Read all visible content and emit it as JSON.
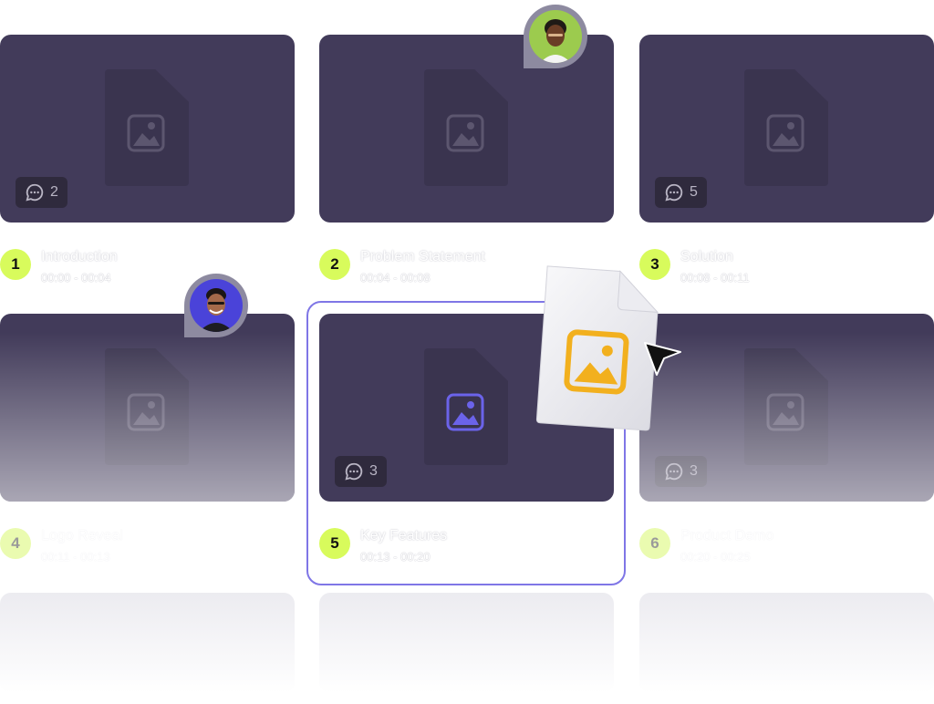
{
  "colors": {
    "card_bg": "#423b5a",
    "number_badge": "#d8fb5c",
    "selection_border": "#7f76e6",
    "accent_icon": "#6b63ea",
    "drag_icon": "#f2b01e"
  },
  "scenes": [
    {
      "number": "1",
      "title": "Introduction",
      "time": "00:00 - 00:04",
      "comments": "2"
    },
    {
      "number": "2",
      "title": "Problem Statement",
      "time": "00:04 - 00:08",
      "comments": ""
    },
    {
      "number": "3",
      "title": "Solution",
      "time": "00:08 - 00:11",
      "comments": "5"
    },
    {
      "number": "4",
      "title": "Logo Reveal",
      "time": "00:11 - 00:13",
      "comments": ""
    },
    {
      "number": "5",
      "title": "Key Features",
      "time": "00:13 - 00:20",
      "comments": "3"
    },
    {
      "number": "6",
      "title": "Product Demo",
      "time": "00:20 - 00:25",
      "comments": "3"
    }
  ],
  "icons": {
    "comment": "comment-bubble-icon",
    "image": "image-file-icon",
    "cursor": "cursor-arrow-icon"
  }
}
